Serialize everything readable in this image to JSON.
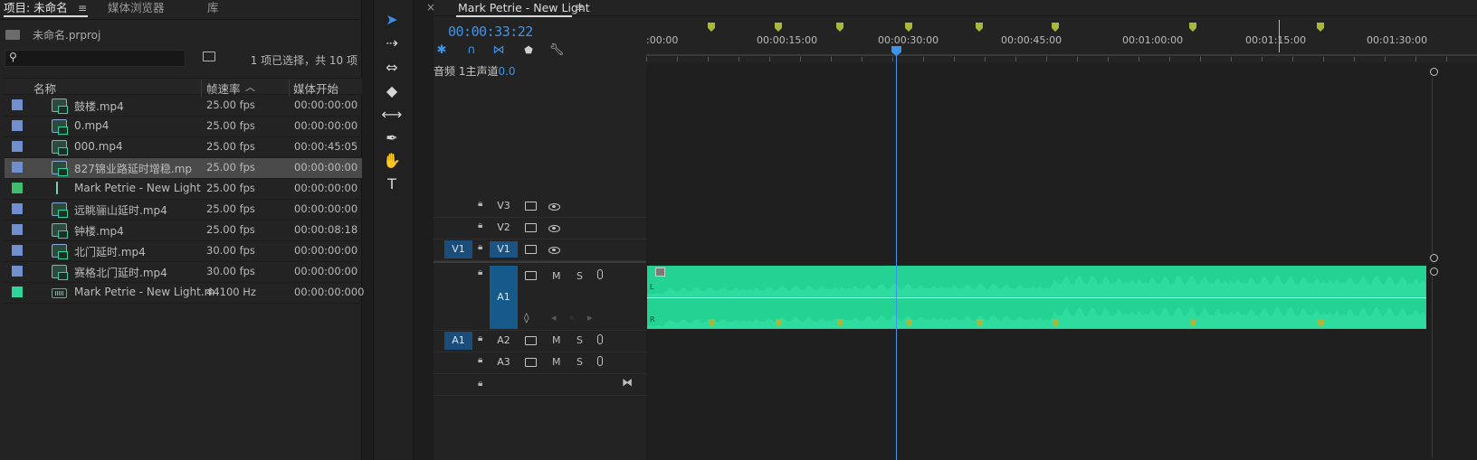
{
  "project": {
    "tabs": [
      {
        "label": "项目: 未命名"
      },
      {
        "label": "媒体浏览器"
      },
      {
        "label": "库"
      }
    ],
    "file": "未命名.prproj",
    "search_placeholder": "",
    "selection_info": "1 项已选择，共 10 项",
    "columns": [
      "名称",
      "帧速率",
      "媒体开始"
    ],
    "sort_indicator": "^",
    "rows": [
      {
        "name": "鼓楼.mp4",
        "fps": "25.00 fps",
        "start": "00:00:00:00",
        "swatch": "#6f8fce",
        "kind": "video"
      },
      {
        "name": "0.mp4",
        "fps": "25.00 fps",
        "start": "00:00:00:00",
        "swatch": "#6f8fce",
        "kind": "video"
      },
      {
        "name": "000.mp4",
        "fps": "25.00 fps",
        "start": "00:00:45:05",
        "swatch": "#6f8fce",
        "kind": "video"
      },
      {
        "name": "827锦业路延时增稳.mp",
        "fps": "25.00 fps",
        "start": "00:00:00:00",
        "swatch": "#6f8fce",
        "kind": "video",
        "selected": true
      },
      {
        "name": "Mark Petrie - New Light",
        "fps": "25.00 fps",
        "start": "00:00:00:00",
        "swatch": "#3ebd6e",
        "kind": "sequence"
      },
      {
        "name": "远眺骊山延时.mp4",
        "fps": "25.00 fps",
        "start": "00:00:00:00",
        "swatch": "#6f8fce",
        "kind": "video"
      },
      {
        "name": "钟楼.mp4",
        "fps": "25.00 fps",
        "start": "00:00:08:18",
        "swatch": "#6f8fce",
        "kind": "video"
      },
      {
        "name": "北门延时.mp4",
        "fps": "30.00 fps",
        "start": "00:00:00:00",
        "swatch": "#6f8fce",
        "kind": "video"
      },
      {
        "name": "赛格北门延时.mp4",
        "fps": "30.00 fps",
        "start": "00:00:00:00",
        "swatch": "#6f8fce",
        "kind": "video"
      },
      {
        "name": "Mark Petrie - New Light.m",
        "fps": "44100 Hz",
        "start": "00:00:00:000",
        "swatch": "#2fd49b",
        "kind": "audio"
      }
    ]
  },
  "tools": [
    {
      "name": "selection-tool-icon",
      "glyph": "➤",
      "active": true
    },
    {
      "name": "track-select-tool-icon",
      "glyph": "⇢"
    },
    {
      "name": "ripple-edit-tool-icon",
      "glyph": "⇔"
    },
    {
      "name": "razor-tool-icon",
      "glyph": "◆"
    },
    {
      "name": "slip-tool-icon",
      "glyph": "⟷"
    },
    {
      "name": "pen-tool-icon",
      "glyph": "✒"
    },
    {
      "name": "hand-tool-icon",
      "glyph": "✋"
    },
    {
      "name": "type-tool-icon",
      "glyph": "T"
    }
  ],
  "timeline": {
    "tab_title": "Mark Petrie - New Light",
    "close_glyph": "×",
    "timecode": "00:00:33:22",
    "ruler_labels": [
      ":00:00",
      "00:00:15:00",
      "00:00:30:00",
      "00:00:45:00",
      "00:01:00:00",
      "00:01:15:00",
      "00:01:30:00"
    ],
    "tracks": {
      "video": [
        "V3",
        "V2",
        "V1"
      ],
      "audio": [
        "A1",
        "A2",
        "A3"
      ],
      "a1_name": "音频 1",
      "source_v": "V1",
      "source_a": "A1",
      "master_label": "主声道",
      "master_value": "0.0",
      "m": "M",
      "s": "S"
    },
    "accent": "#3e94ea",
    "clip_color": "#24d394",
    "marker_color": "#a9b73a"
  }
}
